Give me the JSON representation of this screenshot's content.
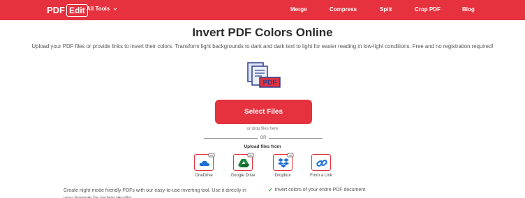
{
  "header": {
    "logo_text": "PDF",
    "logo_box": "Edit",
    "all_tools": "All Tools",
    "nav": [
      "Merge",
      "Compress",
      "Split",
      "Crop PDF",
      "Blog"
    ]
  },
  "main": {
    "title": "Invert PDF Colors Online",
    "subtitle": "Upload your PDF files or provide links to invert their colors. Transform light backgrounds to dark and dark text to light for easier reading in low-light conditions. Free and no registration required!",
    "illustration_label": "PDF",
    "select_button": "Select Files",
    "drop_hint": "or drop files here",
    "or_text": "OR",
    "upload_from": "Upload files from",
    "sources": [
      {
        "label": "OneDrive",
        "icon": "onedrive-icon"
      },
      {
        "label": "Google Drive",
        "icon": "google-drive-icon"
      },
      {
        "label": "Dropbox",
        "icon": "dropbox-icon"
      },
      {
        "label": "From a Link",
        "icon": "link-icon"
      }
    ]
  },
  "footer_info": {
    "description": "Create night-mode friendly PDFs with our easy-to-use inverting tool. Use it directly in your browser for instant results!",
    "feature": "Invert colors of your entire PDF document"
  },
  "colors": {
    "brand": "#e5323e",
    "check": "#2e9e4f",
    "illustration_blue": "#2d3f8f"
  }
}
